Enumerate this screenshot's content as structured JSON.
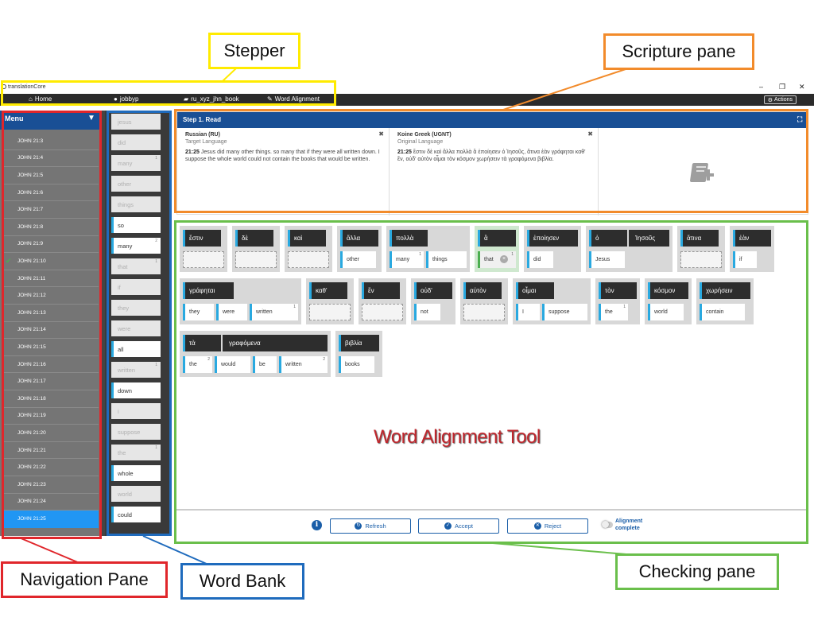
{
  "window": {
    "app_title": "translationCore",
    "minimize": "–",
    "restore": "❐",
    "close": "✕"
  },
  "nav": {
    "home": "Home",
    "user": "jobbyp",
    "project": "ru_xyz_jhn_book",
    "tool": "Word Alignment",
    "actions": "Actions"
  },
  "menu": {
    "title": "Menu",
    "items": [
      "JOHN 21:3",
      "JOHN 21:4",
      "JOHN 21:5",
      "JOHN 21:6",
      "JOHN 21:7",
      "JOHN 21:8",
      "JOHN 21:9",
      "JOHN 21:10",
      "JOHN 21:11",
      "JOHN 21:12",
      "JOHN 21:13",
      "JOHN 21:14",
      "JOHN 21:15",
      "JOHN 21:16",
      "JOHN 21:17",
      "JOHN 21:18",
      "JOHN 21:19",
      "JOHN 21:20",
      "JOHN 21:21",
      "JOHN 21:22",
      "JOHN 21:23",
      "JOHN 21:24",
      "JOHN 21:25"
    ],
    "checked_item": "JOHN 21:10",
    "selected_item": "JOHN 21:25"
  },
  "word_bank": [
    {
      "word": "jesus",
      "used": true,
      "occ": ""
    },
    {
      "word": "did",
      "used": true,
      "occ": ""
    },
    {
      "word": "many",
      "used": true,
      "occ": "1"
    },
    {
      "word": "other",
      "used": true,
      "occ": ""
    },
    {
      "word": "things",
      "used": true,
      "occ": ""
    },
    {
      "word": "so",
      "used": false,
      "occ": ""
    },
    {
      "word": "many",
      "used": false,
      "occ": "2"
    },
    {
      "word": "that",
      "used": true,
      "occ": "1"
    },
    {
      "word": "if",
      "used": true,
      "occ": ""
    },
    {
      "word": "they",
      "used": true,
      "occ": ""
    },
    {
      "word": "were",
      "used": true,
      "occ": ""
    },
    {
      "word": "all",
      "used": false,
      "occ": ""
    },
    {
      "word": "written",
      "used": true,
      "occ": "1"
    },
    {
      "word": "down",
      "used": false,
      "occ": ""
    },
    {
      "word": "i",
      "used": true,
      "occ": ""
    },
    {
      "word": "suppose",
      "used": true,
      "occ": ""
    },
    {
      "word": "the",
      "used": true,
      "occ": "1"
    },
    {
      "word": "whole",
      "used": false,
      "occ": ""
    },
    {
      "word": "world",
      "used": true,
      "occ": ""
    },
    {
      "word": "could",
      "used": false,
      "occ": ""
    }
  ],
  "scripture": {
    "step_title": "Step 1. Read",
    "target": {
      "lang": "Russian (RU)",
      "label": "Target Language",
      "ref": "21:25",
      "text": "Jesus did many other things. so many that if they were all written down. I suppose the whole world could not contain the books that would be written."
    },
    "original": {
      "lang": "Koine Greek (UGNT)",
      "label": "Original Language",
      "ref": "21:25",
      "text": "ἔστιν δὲ καὶ ἄλλα πολλὰ ἃ ἐποίησεν ὁ Ἰησοῦς, ἅτινα ἐὰν γράφηται καθ' ἕν, οὐδ' αὐτὸν οἶμαι τὸν κόσμον χωρήσειν τὰ γραφόμενα βιβλία."
    }
  },
  "alignments": [
    {
      "gk": [
        "ἔστιν"
      ],
      "en": []
    },
    {
      "gk": [
        "δὲ"
      ],
      "en": []
    },
    {
      "gk": [
        "καὶ"
      ],
      "en": []
    },
    {
      "gk": [
        "ἄλλα"
      ],
      "en": [
        {
          "w": "other",
          "o": ""
        }
      ]
    },
    {
      "gk": [
        "πολλὰ"
      ],
      "en": [
        {
          "w": "many",
          "o": "1"
        },
        {
          "w": "things",
          "o": ""
        }
      ]
    },
    {
      "gk": [
        "ἃ"
      ],
      "en": [
        {
          "w": "that",
          "o": "1"
        }
      ]
    },
    {
      "gk": [
        "ἐποίησεν"
      ],
      "en": [
        {
          "w": "did",
          "o": ""
        }
      ]
    },
    {
      "gk": [
        "ὁ",
        "Ἰησοῦς"
      ],
      "en": [
        {
          "w": "Jesus",
          "o": ""
        }
      ]
    },
    {
      "gk": [
        "ἅτινα"
      ],
      "en": []
    },
    {
      "gk": [
        "ἐὰν"
      ],
      "en": [
        {
          "w": "if",
          "o": ""
        }
      ]
    },
    {
      "gk": [
        "γράφηται"
      ],
      "en": [
        {
          "w": "they",
          "o": ""
        },
        {
          "w": "were",
          "o": ""
        },
        {
          "w": "written",
          "o": "1"
        }
      ]
    },
    {
      "gk": [
        "καθ'"
      ],
      "en": []
    },
    {
      "gk": [
        "ἕν"
      ],
      "en": []
    },
    {
      "gk": [
        "οὐδ'"
      ],
      "en": [
        {
          "w": "not",
          "o": ""
        }
      ]
    },
    {
      "gk": [
        "αὐτὸν"
      ],
      "en": []
    },
    {
      "gk": [
        "οἶμαι"
      ],
      "en": [
        {
          "w": "I",
          "o": ""
        },
        {
          "w": "suppose",
          "o": ""
        }
      ]
    },
    {
      "gk": [
        "τὸν"
      ],
      "en": [
        {
          "w": "the",
          "o": "1"
        }
      ]
    },
    {
      "gk": [
        "κόσμον"
      ],
      "en": [
        {
          "w": "world",
          "o": ""
        }
      ]
    },
    {
      "gk": [
        "χωρήσειν"
      ],
      "en": [
        {
          "w": "contain",
          "o": ""
        }
      ]
    },
    {
      "gk": [
        "τὰ",
        "γραφόμενα"
      ],
      "en": [
        {
          "w": "the",
          "o": "2"
        },
        {
          "w": "would",
          "o": ""
        },
        {
          "w": "be",
          "o": ""
        },
        {
          "w": "written",
          "o": "2"
        }
      ]
    },
    {
      "gk": [
        "βιβλία"
      ],
      "en": [
        {
          "w": "books",
          "o": ""
        }
      ]
    }
  ],
  "toolbar": {
    "refresh": "Refresh",
    "accept": "Accept",
    "reject": "Reject",
    "complete": "Alignment complete",
    "info": "i"
  },
  "watermark": "Word Alignment Tool",
  "annotations": {
    "stepper": "Stepper",
    "scripture_pane": "Scripture pane",
    "navigation_pane": "Navigation Pane",
    "word_bank": "Word Bank",
    "checking_pane": "Checking pane"
  },
  "colors": {
    "stepper": "#ffeb00",
    "scripture": "#f28b2b",
    "navigation": "#e0262b",
    "wordbank": "#1f6bbd",
    "checking": "#6abf4b",
    "header_blue": "#194f95",
    "selected": "#2196f3"
  }
}
